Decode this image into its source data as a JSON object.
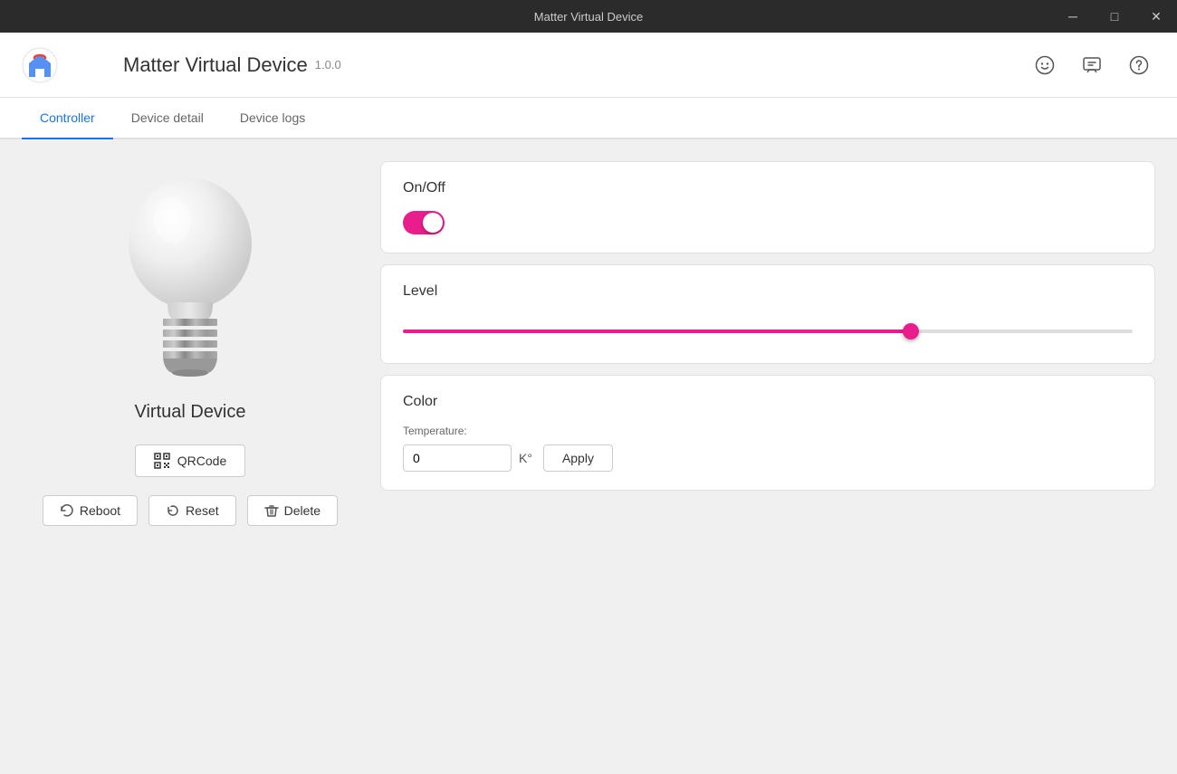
{
  "titlebar": {
    "title": "Matter Virtual Device",
    "minimize_label": "─",
    "maximize_label": "□",
    "close_label": "✕"
  },
  "header": {
    "app_title": "Matter Virtual Device",
    "app_version": "1.0.0",
    "icons": {
      "emoji_label": "☺",
      "feedback_label": "⊡",
      "help_label": "?"
    }
  },
  "tabs": [
    {
      "id": "controller",
      "label": "Controller",
      "active": true
    },
    {
      "id": "device-detail",
      "label": "Device detail",
      "active": false
    },
    {
      "id": "device-logs",
      "label": "Device logs",
      "active": false
    }
  ],
  "left_panel": {
    "device_name": "Virtual Device",
    "qrcode_button": "QRCode",
    "reboot_button": "Reboot",
    "reset_button": "Reset",
    "delete_button": "Delete"
  },
  "cards": {
    "onoff": {
      "title": "On/Off",
      "state": true
    },
    "level": {
      "title": "Level",
      "value": 70,
      "min": 0,
      "max": 100
    },
    "color": {
      "title": "Color",
      "temperature_label": "Temperature:",
      "temperature_value": "0",
      "temperature_unit": "K°",
      "apply_label": "Apply"
    }
  },
  "colors": {
    "accent": "#e91e8c",
    "active_tab": "#1a73e8"
  }
}
